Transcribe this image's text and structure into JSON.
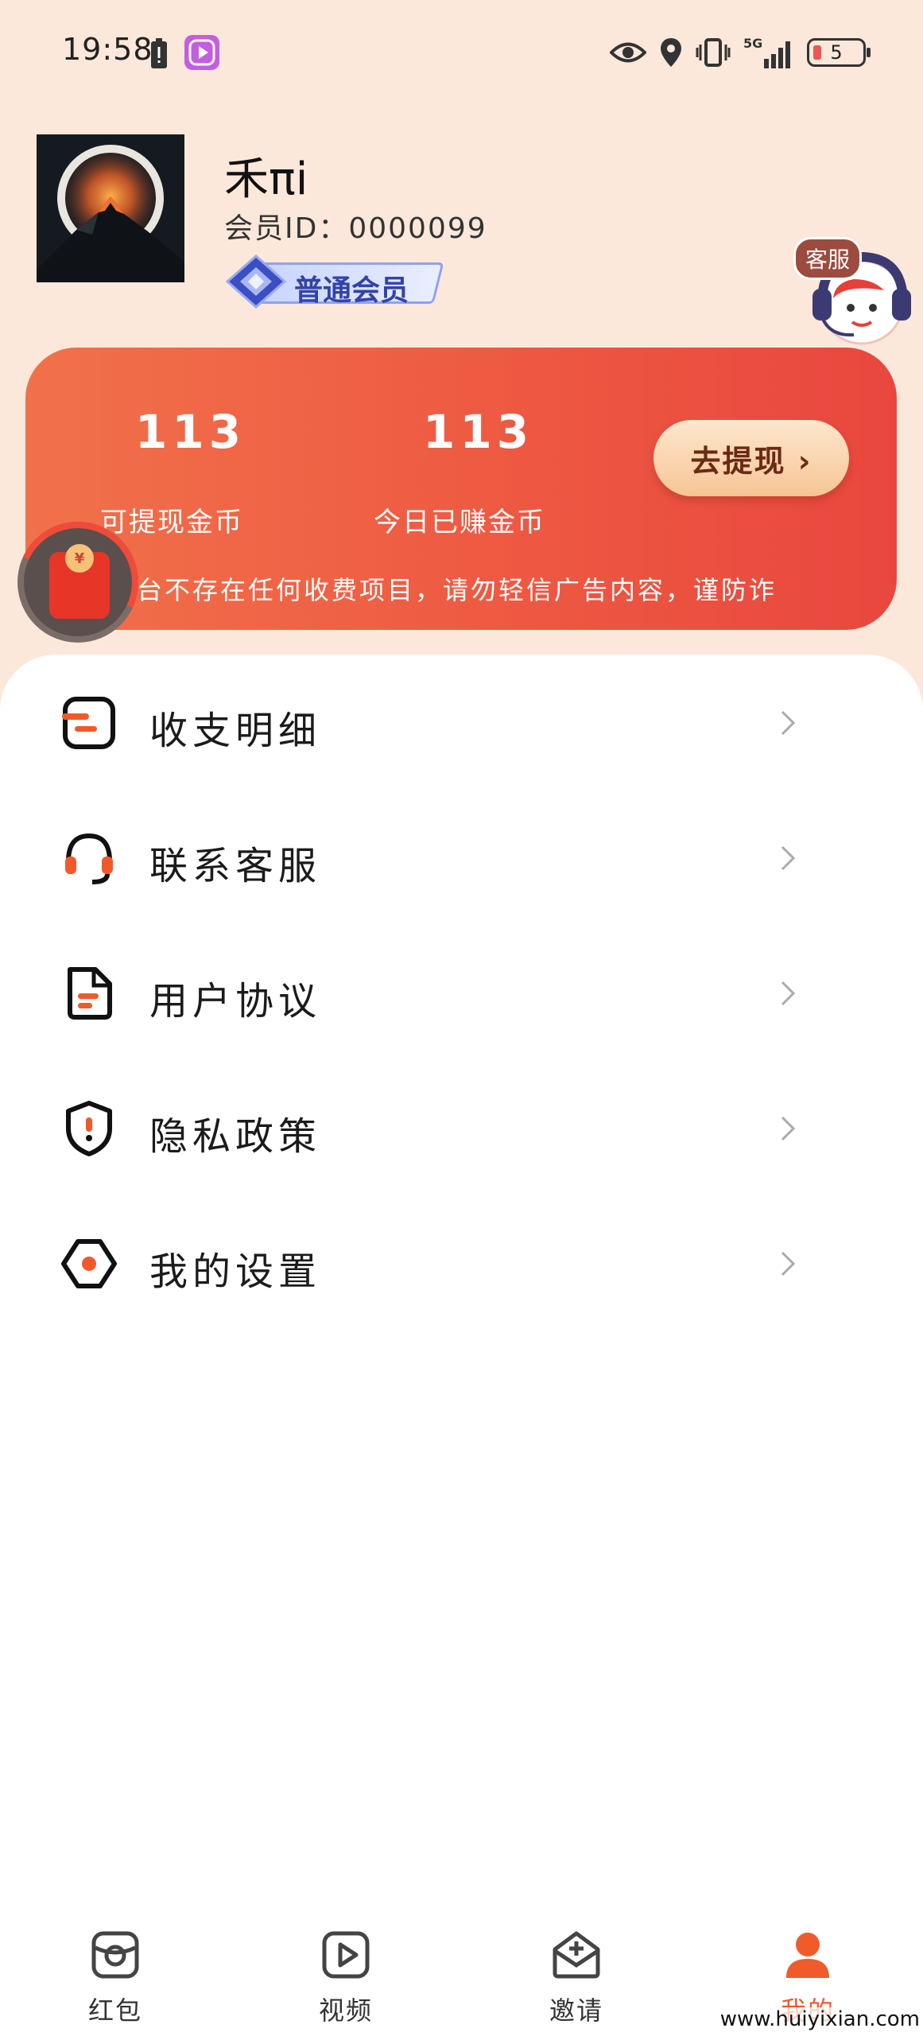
{
  "status_bar": {
    "time": "19:58",
    "battery_level": "5",
    "network": "5G"
  },
  "profile": {
    "username": "禾πi",
    "member_id": "会员ID：0000099",
    "member_level": "普通会员"
  },
  "customer_service_float": {
    "label": "客服"
  },
  "earnings": {
    "withdrawable_coins": "113",
    "withdrawable_label": "可提现金币",
    "today_earned_coins": "113",
    "today_earned_label": "今日已赚金币",
    "withdraw_button": "去提现 ›",
    "notice": "台不存在任何收费项目，请勿轻信广告内容，谨防诈"
  },
  "menu": {
    "items": [
      {
        "label": "收支明细",
        "icon": "ledger-icon"
      },
      {
        "label": "联系客服",
        "icon": "headset-icon"
      },
      {
        "label": "用户协议",
        "icon": "document-icon"
      },
      {
        "label": "隐私政策",
        "icon": "shield-icon"
      },
      {
        "label": "我的设置",
        "icon": "settings-icon"
      }
    ]
  },
  "bottom_nav": {
    "items": [
      {
        "label": "红包",
        "icon": "red-packet-icon",
        "active": false
      },
      {
        "label": "视频",
        "icon": "video-icon",
        "active": false
      },
      {
        "label": "邀请",
        "icon": "invite-icon",
        "active": false
      },
      {
        "label": "我的",
        "icon": "user-icon",
        "active": true
      }
    ]
  },
  "watermark": "www.huiyixian.com",
  "colors": {
    "accent": "#f15a2b",
    "card_start": "#f1714a",
    "card_end": "#e9473e",
    "background": "#fbe8da"
  }
}
